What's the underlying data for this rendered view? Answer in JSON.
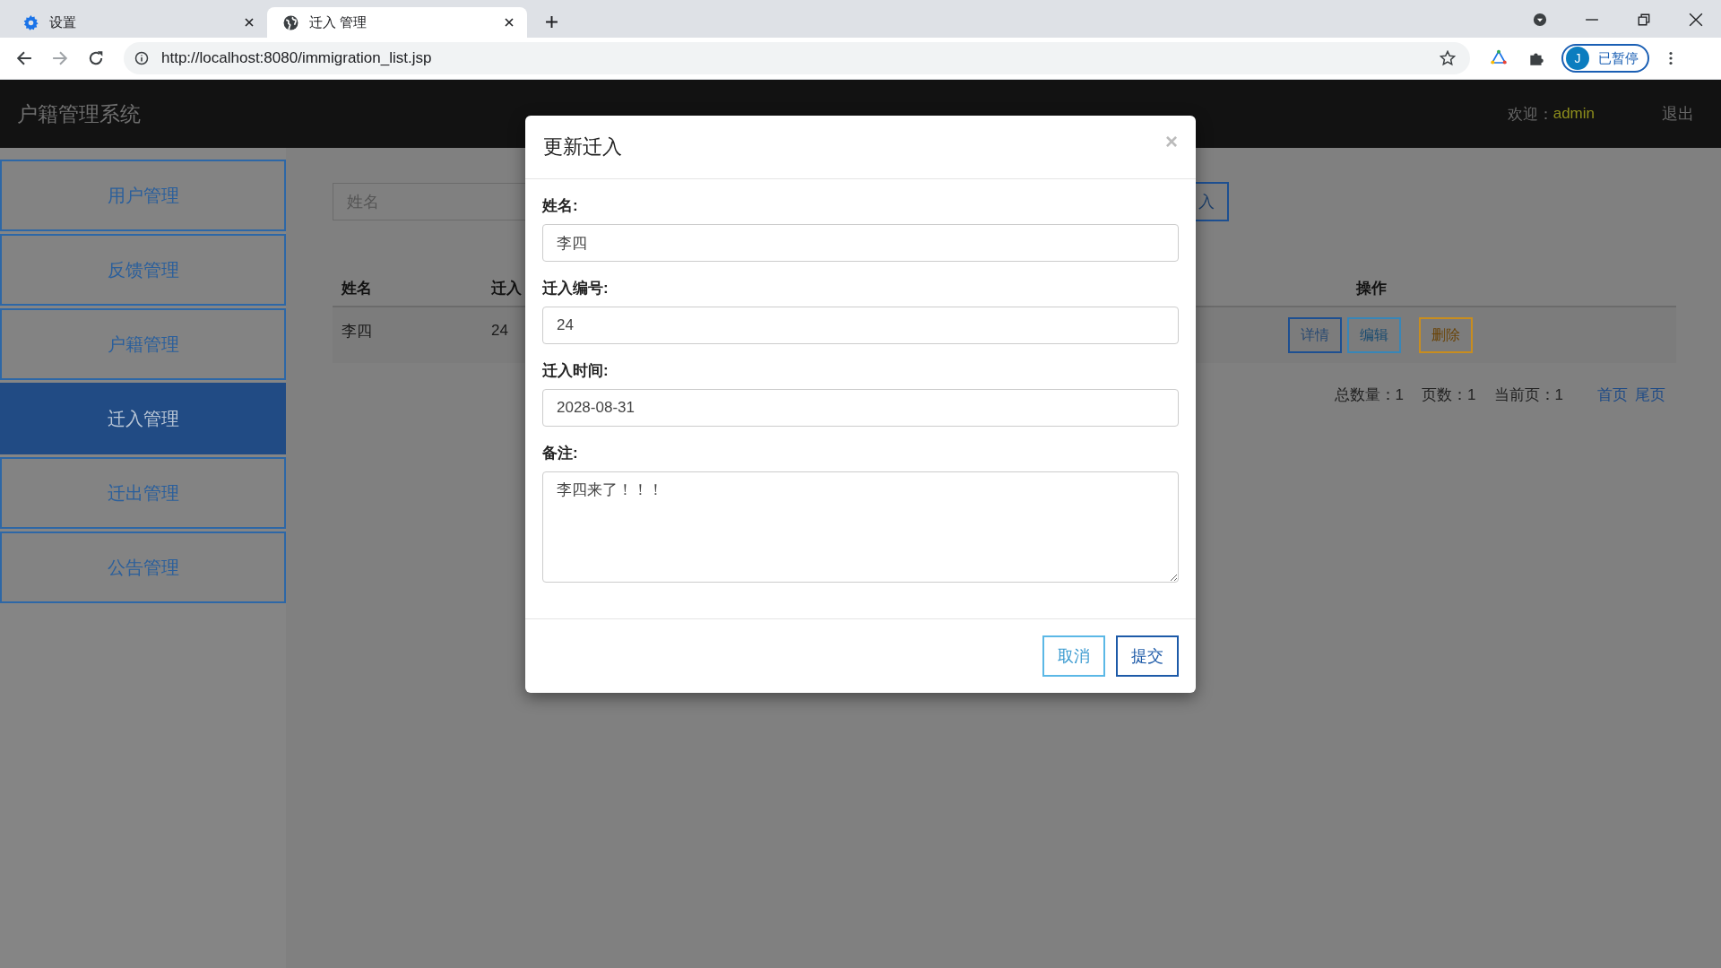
{
  "browser": {
    "tabs": [
      {
        "title": "设置",
        "selected": false,
        "kind": "settings"
      },
      {
        "title": "迁入 管理",
        "selected": true,
        "kind": "web"
      }
    ],
    "url": "http://localhost:8080/immigration_list.jsp",
    "profile": {
      "initial": "J",
      "status": "已暂停"
    }
  },
  "header": {
    "title": "户籍管理系统",
    "welcome": "欢迎：",
    "user": "admin",
    "logout": "退出"
  },
  "sidebar": {
    "items": [
      {
        "label": "用户管理",
        "selected": false
      },
      {
        "label": "反馈管理",
        "selected": false
      },
      {
        "label": "户籍管理",
        "selected": false
      },
      {
        "label": "迁入管理",
        "selected": true
      },
      {
        "label": "迁出管理",
        "selected": false
      },
      {
        "label": "公告管理",
        "selected": false
      }
    ]
  },
  "search": {
    "placeholder": "姓名",
    "button": "入"
  },
  "table": {
    "columns": [
      "姓名",
      "迁入",
      "操作"
    ],
    "rows": [
      {
        "cells": [
          "李四",
          "24"
        ],
        "actions": [
          {
            "label": "详情",
            "kind": "primary"
          },
          {
            "label": "编辑",
            "kind": "info"
          },
          {
            "label": "删除",
            "kind": "warning"
          }
        ]
      }
    ]
  },
  "pagination": {
    "items": [
      {
        "label": "总数量：",
        "value": "1"
      },
      {
        "label": "页数：",
        "value": "1"
      },
      {
        "label": "当前页：",
        "value": "1"
      }
    ],
    "links": [
      "首页",
      "尾页"
    ]
  },
  "dialog": {
    "title": "更新迁入",
    "close": "×",
    "fields": [
      {
        "label": "姓名:",
        "value": "李四",
        "kind": "input"
      },
      {
        "label": "迁入编号:",
        "value": "24",
        "kind": "input"
      },
      {
        "label": "迁入时间:",
        "value": "2028-08-31",
        "kind": "input"
      },
      {
        "label": "备注:",
        "value": "李四来了！！！",
        "kind": "textarea"
      }
    ],
    "buttons": [
      {
        "label": "取消",
        "kind": "default"
      },
      {
        "label": "提交",
        "kind": "primary"
      }
    ]
  }
}
